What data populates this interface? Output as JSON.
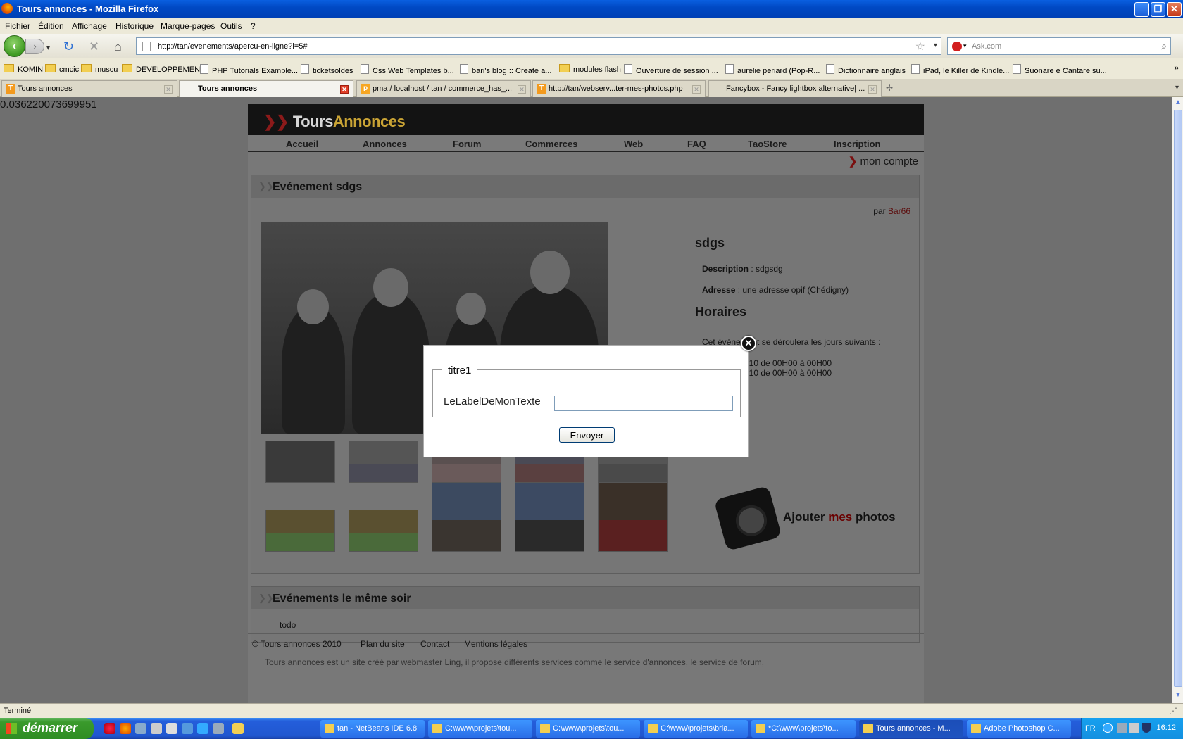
{
  "window": {
    "title": "Tours annonces - Mozilla Firefox"
  },
  "menu": [
    "Fichier",
    "Édition",
    "Affichage",
    "Historique",
    "Marque-pages",
    "Outils",
    "?"
  ],
  "url": "http://tan/evenements/apercu-en-ligne?i=5#",
  "search": {
    "placeholder": "Ask.com"
  },
  "bookmarks": [
    {
      "label": "KOMIN",
      "type": "folder"
    },
    {
      "label": "cmcic",
      "type": "folder"
    },
    {
      "label": "muscu",
      "type": "folder"
    },
    {
      "label": "DEVELOPPEMENT",
      "type": "folder"
    },
    {
      "label": "PHP Tutorials Example...",
      "type": "page"
    },
    {
      "label": "ticketsoldes",
      "type": "page"
    },
    {
      "label": "Css Web Templates b...",
      "type": "page"
    },
    {
      "label": "bari's blog :: Create a...",
      "type": "page"
    },
    {
      "label": "modules flash",
      "type": "folder"
    },
    {
      "label": "Ouverture de session ...",
      "type": "page"
    },
    {
      "label": "aurelie periard (Pop-R...",
      "type": "page"
    },
    {
      "label": "Dictionnaire anglais",
      "type": "page"
    },
    {
      "label": "iPad, le Killer de Kindle...",
      "type": "page"
    },
    {
      "label": "Suonare e Cantare su...",
      "type": "page"
    }
  ],
  "tabs": [
    {
      "label": "Tours annonces",
      "active": false
    },
    {
      "label": "Tours annonces",
      "active": true
    },
    {
      "label": "pma / localhost / tan / commerce_has_...",
      "active": false
    },
    {
      "label": "http://tan/webserv...ter-mes-photos.php",
      "active": false
    },
    {
      "label": "Fancybox - Fancy lightbox alternative| ...",
      "active": false
    }
  ],
  "debug_value": "0.036220073699951",
  "site": {
    "logo_part1": "Tours",
    "logo_part2": "Annonces",
    "nav": [
      "Accueil",
      "Annonces",
      "Forum",
      "Commerces",
      "Web",
      "FAQ",
      "TaoStore",
      "Inscription"
    ],
    "account": "mon compte",
    "event": {
      "panel_title": "Evénement sdgs",
      "by_prefix": "par",
      "author": "Bar66",
      "name": "sdgs",
      "description_label": "Description",
      "description_value": " : sdgsdg",
      "address_label": "Adresse",
      "address_value": " : une adresse opif (Chédigny)",
      "schedule_title": "Horaires",
      "schedule_intro": "Cet événement se déroulera les jours suivants :",
      "schedule_lines": [
        "010 de 00H00 à 00H00",
        "010 de 00H00 à 00H00"
      ],
      "add_photos_1": "Ajouter ",
      "add_photos_2": "mes",
      "add_photos_3": " photos"
    },
    "same_evening": {
      "title": "Evénements le même soir",
      "text": "todo"
    },
    "footer": {
      "copyright": "© Tours annonces 2010",
      "links": [
        "Plan du site",
        "Contact",
        "Mentions légales"
      ],
      "about": "Tours annonces est un site créé par webmaster Ling, il propose différents services comme le service d'annonces, le service de forum,"
    }
  },
  "modal": {
    "legend": "titre1",
    "label": "LeLabelDeMonTexte",
    "input_value": "",
    "submit": "Envoyer",
    "close_icon": "close-icon"
  },
  "status": "Terminé",
  "taskbar": {
    "start": "démarrer",
    "tasks": [
      {
        "label": "tan - NetBeans IDE 6.8",
        "active": false
      },
      {
        "label": "C:\\www\\projets\\tou...",
        "active": false
      },
      {
        "label": "C:\\www\\projets\\tou...",
        "active": false
      },
      {
        "label": "C:\\www\\projets\\bria...",
        "active": false
      },
      {
        "label": "*C:\\www\\projets\\to...",
        "active": false
      },
      {
        "label": "Tours annonces - M...",
        "active": true
      },
      {
        "label": "Adobe Photoshop C...",
        "active": false
      }
    ],
    "lang": "FR",
    "clock": "16:12"
  }
}
